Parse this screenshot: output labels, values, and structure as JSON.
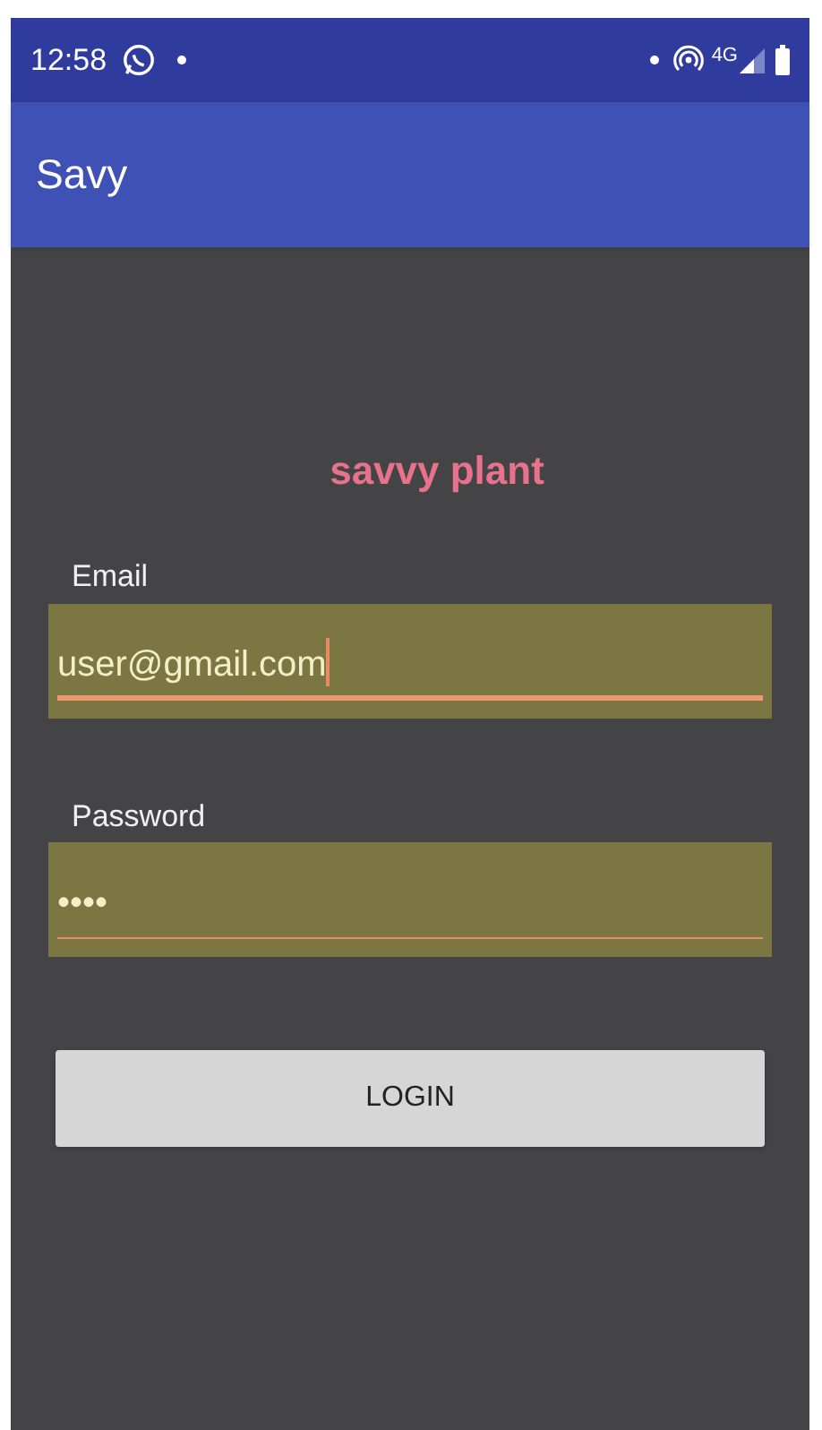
{
  "status_bar": {
    "time": "12:58",
    "network": "4G"
  },
  "app_bar": {
    "title": "Savy"
  },
  "heading": "savvy plant",
  "fields": [
    {
      "label": "Email",
      "value": "user@gmail.com",
      "focused": true
    },
    {
      "label": "Password",
      "value": "••••",
      "focused": false
    }
  ],
  "button": "LOGIN"
}
